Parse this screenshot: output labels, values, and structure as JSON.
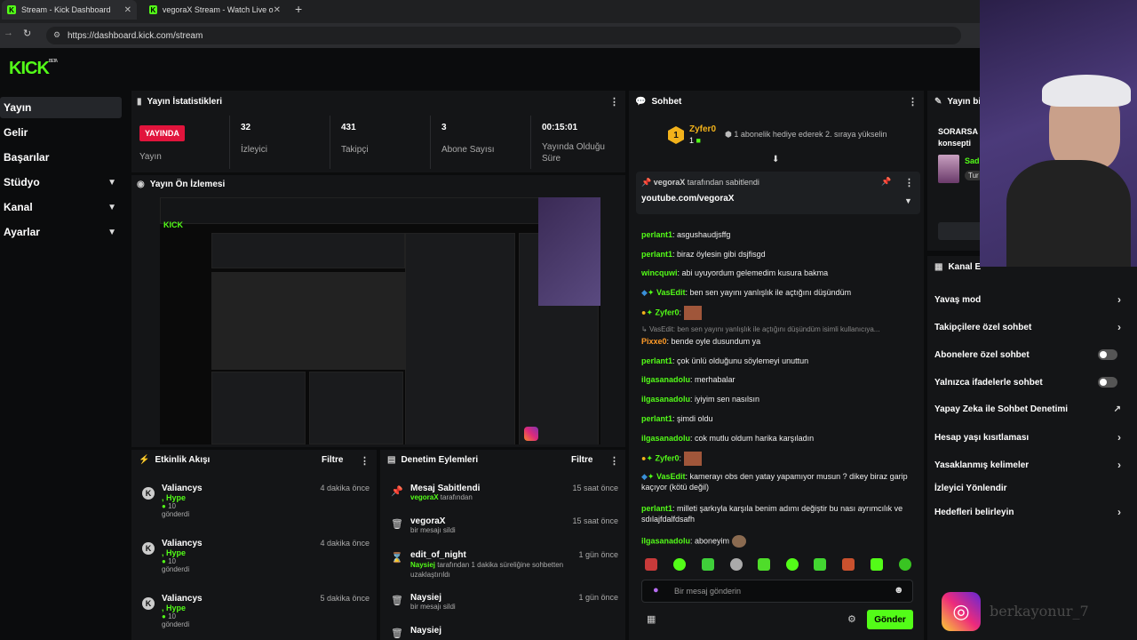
{
  "browser": {
    "tabs": [
      {
        "title": "Stream - Kick Dashboard",
        "active": true
      },
      {
        "title": "vegoraX Stream - Watch Live o",
        "active": false
      }
    ],
    "url": "https://dashboard.kick.com/stream"
  },
  "logo": "KICK",
  "logo_sup": "BETA",
  "sidebar": {
    "items": [
      {
        "label": "Yayın",
        "expandable": false,
        "active": true
      },
      {
        "label": "Gelir",
        "expandable": false
      },
      {
        "label": "Başarılar",
        "expandable": false
      },
      {
        "label": "Stüdyo",
        "expandable": true
      },
      {
        "label": "Kanal",
        "expandable": true
      },
      {
        "label": "Ayarlar",
        "expandable": true
      }
    ]
  },
  "stats": {
    "title": "Yayın İstatistikleri",
    "live_badge": "YAYINDA",
    "live_label": "Yayın",
    "items": [
      {
        "value": "32",
        "label": "İzleyici"
      },
      {
        "value": "431",
        "label": "Takipçi"
      },
      {
        "value": "3",
        "label": "Abone Sayısı"
      },
      {
        "value": "00:15:01",
        "label": "Yayında Olduğu Süre"
      }
    ]
  },
  "preview": {
    "title": "Yayın Ön İzlemesi"
  },
  "activity": {
    "title": "Etkinlik Akışı",
    "filter": "Filtre",
    "items": [
      {
        "name": "Valiancys",
        "hype": ", Hype",
        "count": "10",
        "sub": "gönderdi",
        "time": "4 dakika önce"
      },
      {
        "name": "Valiancys",
        "hype": ", Hype",
        "count": "10",
        "sub": "gönderdi",
        "time": "4 dakika önce"
      },
      {
        "name": "Valiancys",
        "hype": ", Hype",
        "count": "10",
        "sub": "gönderdi",
        "time": "5 dakika önce"
      }
    ]
  },
  "moderation": {
    "title": "Denetim Eylemleri",
    "filter": "Filtre",
    "items": [
      {
        "icon": "pin-icon",
        "title": "Mesaj Sabitlendi",
        "user": "vegoraX",
        "sub": " tarafından",
        "time": "15 saat önce"
      },
      {
        "icon": "trash-icon",
        "title": "vegoraX",
        "user": "",
        "sub": "bir mesajı sildi",
        "time": "15 saat önce"
      },
      {
        "icon": "hourglass-icon",
        "title": "edit_of_night",
        "user": "Naysiej",
        "sub": " tarafından 1 dakika süreliğine sohbetten uzaklaştırıldı",
        "time": "1 gün önce"
      },
      {
        "icon": "trash-icon",
        "title": "Naysiej",
        "user": "",
        "sub": "bir mesajı sildi",
        "time": "1 gün önce"
      },
      {
        "icon": "trash-icon",
        "title": "Naysiej",
        "user": "",
        "sub": "",
        "time": ""
      }
    ]
  },
  "chat": {
    "title": "Sohbet",
    "top_gifter": {
      "rank": "1",
      "name": "Zyfer0",
      "count": "1",
      "text": "1 abonelik hediye ederek 2. sıraya yükselin"
    },
    "pinned": {
      "by_user": "vegoraX",
      "by_text": "tarafından sabitlendi",
      "text": "youtube.com/vegoraX"
    },
    "messages": [
      {
        "user": "perlant1",
        "color": "g",
        "text": "asgushaudjsffg"
      },
      {
        "user": "perlant1",
        "color": "g",
        "text": "biraz öylesin gibi dsjfisgd"
      },
      {
        "user": "wincquwi",
        "color": "g",
        "text": "abi uyuyordum gelemedim kusura bakma"
      },
      {
        "user": "VasEdit",
        "color": "g",
        "text": "ben sen yayını yanlışlık ile açtığını düşündüm"
      },
      {
        "user": "Zyfer0",
        "color": "g",
        "text": ""
      },
      {
        "user": "",
        "color": "",
        "text": "VasEdit: ben sen yayını yanlışlık ile açtığını düşündüm isimli kullanıcıya..."
      },
      {
        "user": "Pixxe0",
        "color": "o",
        "text": "bende oyle dusundum ya"
      },
      {
        "user": "perlant1",
        "color": "g",
        "text": "çok ünlü olduğunu söylemeyi unuttun"
      },
      {
        "user": "ilgasanadolu",
        "color": "g",
        "text": "merhabalar"
      },
      {
        "user": "ilgasanadolu",
        "color": "g",
        "text": "iyiyim sen nasılsın"
      },
      {
        "user": "perlant1",
        "color": "g",
        "text": "şimdi oldu"
      },
      {
        "user": "ilgasanadolu",
        "color": "g",
        "text": "cok mutlu oldum harika karşıladın"
      },
      {
        "user": "Zyfer0",
        "color": "g",
        "text": ""
      },
      {
        "user": "VasEdit",
        "color": "g",
        "text": "kamerayı obs den yatay yapamıyor musun ? dikey biraz garip kaçıyor (kötü değil)"
      },
      {
        "user": "perlant1",
        "color": "g",
        "text": "milleti şarkıyla karşıla benim adımı değiştir bu nası ayrımcılık ve sdılajfdalfdsafh"
      },
      {
        "user": "ilgasanadolu",
        "color": "g",
        "text": "aboneyim"
      }
    ],
    "input_placeholder": "Bir mesaj gönderin",
    "send_label": "Gönder"
  },
  "right_panel": {
    "title_partial": "Yayın bi",
    "card_text1": "SORARSA",
    "card_text2": "konsepti",
    "card_sub1": "Sad",
    "card_sub2": "Tur",
    "chat_settings_title": "Kanal E",
    "settings": [
      {
        "label": "Yavaş mod",
        "type": "chevron"
      },
      {
        "label": "Takipçilere özel sohbet",
        "type": "chevron"
      },
      {
        "label": "Abonelere özel sohbet",
        "type": "toggle"
      },
      {
        "label": "Yalnızca ifadelerle sohbet",
        "type": "toggle"
      },
      {
        "label": "Yapay Zeka ile Sohbet Denetimi",
        "type": "external"
      },
      {
        "label": "Hesap yaşı kısıtlaması",
        "type": "chevron"
      },
      {
        "label": "Yasaklanmış kelimeler",
        "type": "chevron"
      },
      {
        "label": "İzleyici Yönlendir",
        "type": "none"
      },
      {
        "label": "Hedefleri belirleyin",
        "type": "chevron"
      }
    ]
  },
  "watermark": "berkayonur_7",
  "colors": {
    "accent": "#53fc18",
    "live": "#e1143c",
    "panel": "#141517",
    "background": "#0b0c0d"
  }
}
